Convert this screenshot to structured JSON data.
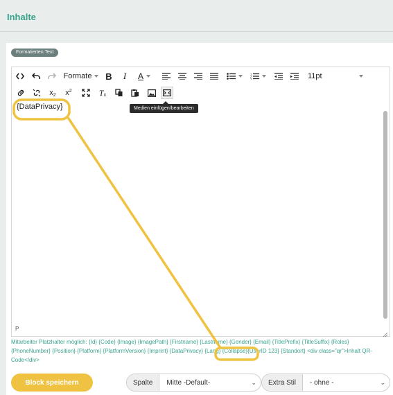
{
  "page": {
    "title": "Inhalte"
  },
  "badge": "Formatierten Text",
  "toolbar": {
    "format_label": "Formate",
    "font_size": "11pt",
    "tooltip": "Medien einfügen/bearbeiten"
  },
  "editor": {
    "content": "{DataPrivacy}",
    "status_path": "P"
  },
  "placeholders": {
    "text": "Mitarbeiter Platzhalter möglich: {Id} {Code} {Image} {ImagePath} {Firstname} {Lastname} {Gender} {Email} {TitlePrefix} {TitleSuffix} {Roles} {PhoneNumber} {Position} {Platform} {PlatformVersion} {Imprint} {DataPrivacy} {Lang} {Collapse}{UserID 123} {Standort} <div class=\"qr\">Inhalt QR-Code</div>"
  },
  "footer": {
    "save_label": "Block speichern",
    "column_label": "Spalte",
    "column_value": "Mitte -Default-",
    "style_label": "Extra Stil",
    "style_value": "- ohne -"
  },
  "colors": {
    "accent": "#3aa38e",
    "highlight": "#efc341",
    "badge": "#6b7f7c"
  }
}
